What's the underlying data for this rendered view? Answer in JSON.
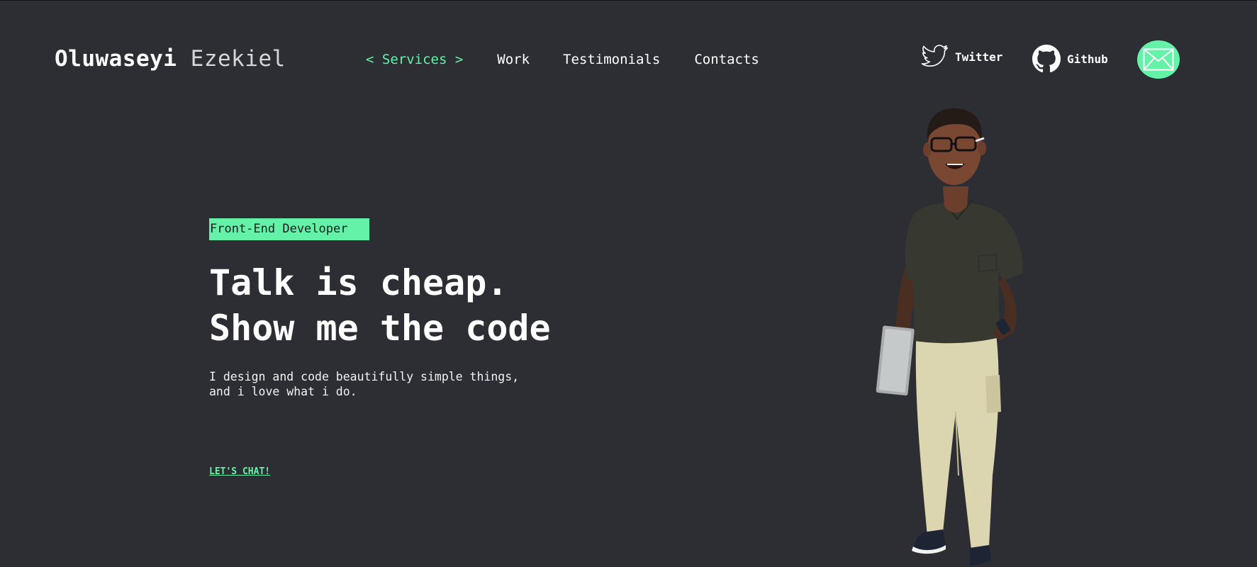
{
  "header": {
    "brand_first": "Oluwaseyi",
    "brand_last": "Ezekiel",
    "nav": {
      "services": "< Services >",
      "work": "Work",
      "testimonials": "Testimonials",
      "contacts": "Contacts"
    },
    "social": {
      "twitter": "Twitter",
      "github": "Github"
    },
    "mail_icon": "envelope-icon"
  },
  "hero": {
    "role": "Front-End Developer",
    "headline_line1": "Talk is cheap.",
    "headline_line2": "Show me the code",
    "tagline_line1": "I design and code beautifully simple things,",
    "tagline_line2": "and i love what i do.",
    "cta": "LET'S CHAT!"
  },
  "colors": {
    "background": "#2d2e33",
    "accent": "#63f2a8",
    "text": "#ffffff"
  }
}
